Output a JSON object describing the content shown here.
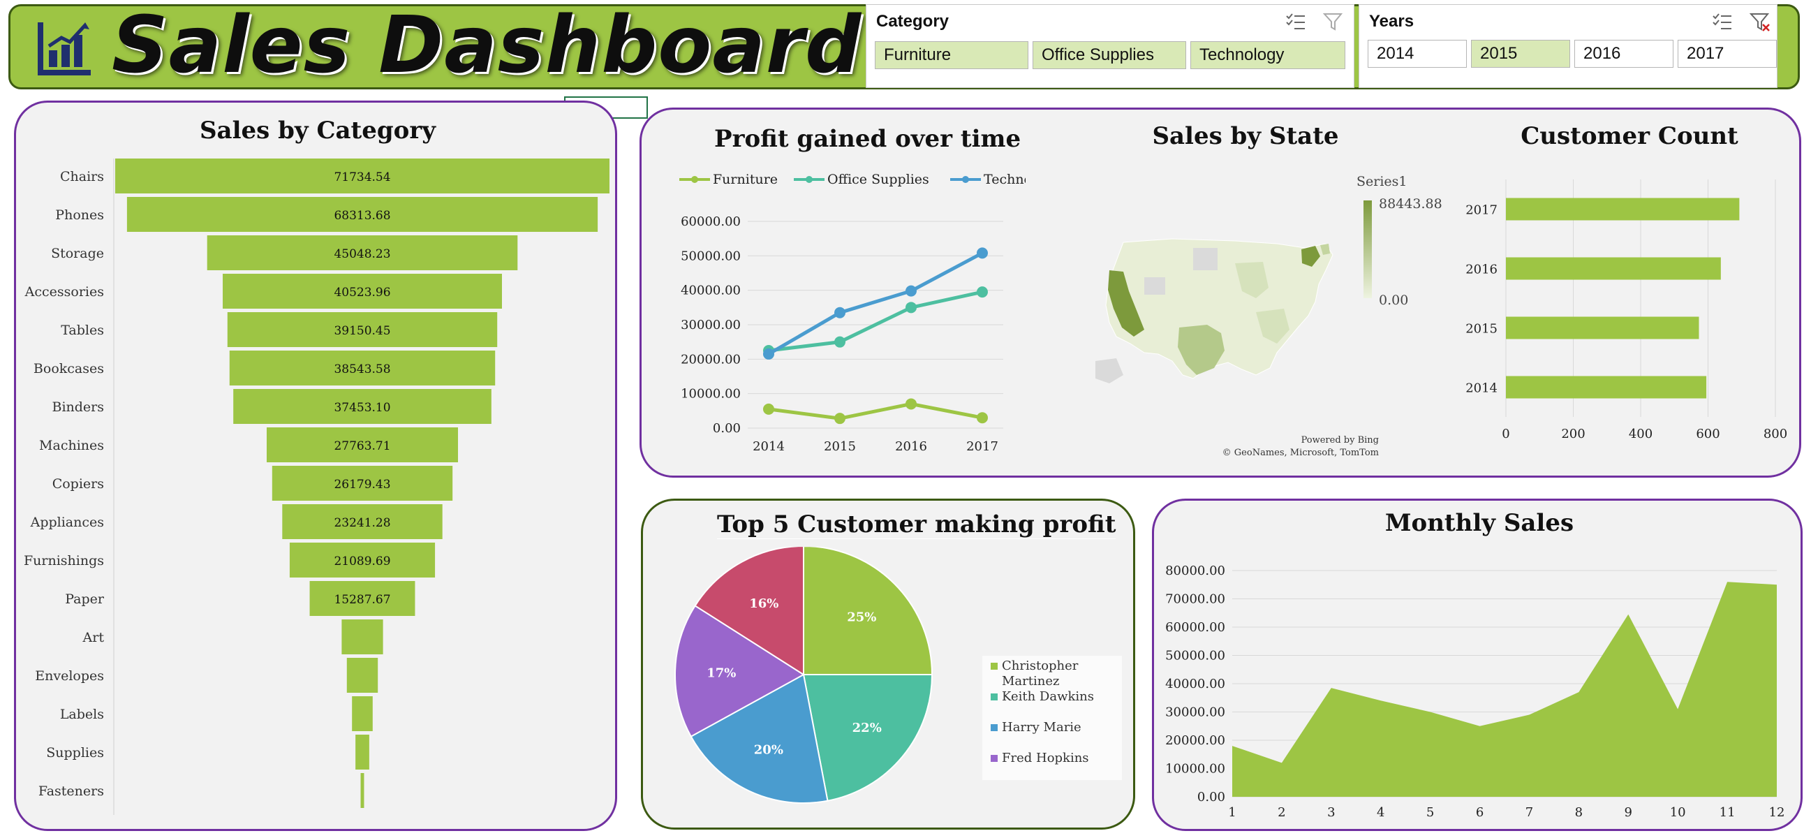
{
  "header": {
    "title": "Sales Dashboard",
    "logo_icon": "bar-chart-icon"
  },
  "slicers": {
    "category": {
      "title": "Category",
      "items": [
        {
          "label": "Furniture",
          "selected": true
        },
        {
          "label": "Office Supplies",
          "selected": true
        },
        {
          "label": "Technology",
          "selected": true
        }
      ],
      "icons": [
        "multi-select-icon",
        "clear-filter-icon"
      ]
    },
    "years": {
      "title": "Years",
      "items": [
        {
          "label": "2014",
          "selected": false
        },
        {
          "label": "2015",
          "selected": true
        },
        {
          "label": "2016",
          "selected": false
        },
        {
          "label": "2017",
          "selected": false
        }
      ],
      "icons": [
        "multi-select-icon",
        "clear-filter-icon"
      ]
    }
  },
  "colors": {
    "accent_green": "#9dc544",
    "panel_border_purple": "#7030a0",
    "panel_border_green": "#3c5a12",
    "panel_bg": "#f2f2f2",
    "teal": "#4dbfa0",
    "blue": "#4a9ccf",
    "pink": "#c74b6c",
    "purple": "#9966cc"
  },
  "chart_data": [
    {
      "id": "sales_by_category",
      "type": "bar",
      "title": "Sales by Category",
      "orientation": "horizontal-funnel",
      "categories": [
        "Chairs",
        "Phones",
        "Storage",
        "Accessories",
        "Tables",
        "Bookcases",
        "Binders",
        "Machines",
        "Copiers",
        "Appliances",
        "Furnishings",
        "Paper",
        "Art",
        "Envelopes",
        "Labels",
        "Supplies",
        "Fasteners"
      ],
      "values": [
        71734.54,
        68313.68,
        45048.23,
        40523.96,
        39150.45,
        38543.58,
        37453.1,
        27763.71,
        26179.43,
        23241.28,
        21089.69,
        15287.67,
        6000,
        4500,
        3000,
        2000,
        500
      ],
      "value_labels": [
        "71734.54",
        "68313.68",
        "45048.23",
        "40523.96",
        "39150.45",
        "38543.58",
        "37453.10",
        "27763.71",
        "26179.43",
        "23241.28",
        "21089.69",
        "15287.67",
        "",
        "",
        "",
        "",
        ""
      ]
    },
    {
      "id": "profit_over_time",
      "type": "line",
      "title": "Profit gained over time",
      "x": [
        "2014",
        "2015",
        "2016",
        "2017"
      ],
      "series": [
        {
          "name": "Furniture",
          "values": [
            5500,
            2800,
            7000,
            3000
          ],
          "color": "#9dc544"
        },
        {
          "name": "Office Supplies",
          "values": [
            22500,
            25000,
            35000,
            39500
          ],
          "color": "#4dbfa0"
        },
        {
          "name": "Technology",
          "values": [
            21500,
            33500,
            39800,
            50800
          ],
          "color": "#4a9ccf"
        }
      ],
      "yticks": [
        "0.00",
        "10000.00",
        "20000.00",
        "30000.00",
        "40000.00",
        "50000.00",
        "60000.00"
      ],
      "ylim": [
        0,
        60000
      ],
      "legend": "top"
    },
    {
      "id": "sales_by_state",
      "type": "map",
      "title": "Sales by State",
      "series_name": "Series1",
      "scale_max": "88443.88",
      "scale_min": "0.00",
      "attribution_line1": "Powered by Bing",
      "attribution_line2": "© GeoNames, Microsoft, TomTom"
    },
    {
      "id": "customer_count",
      "type": "bar",
      "title": "Customer Count",
      "orientation": "horizontal",
      "categories": [
        "2017",
        "2016",
        "2015",
        "2014"
      ],
      "values": [
        693,
        638,
        573,
        595
      ],
      "xticks": [
        "0",
        "200",
        "400",
        "600",
        "800"
      ],
      "xlim": [
        0,
        800
      ]
    },
    {
      "id": "top5_customers",
      "type": "pie",
      "title": "Top 5 Customer making profit",
      "slices": [
        {
          "name": "Christopher Martinez",
          "value": 25,
          "label": "25%",
          "color": "#9dc544"
        },
        {
          "name": "Keith Dawkins",
          "value": 22,
          "label": "22%",
          "color": "#4dbfa0"
        },
        {
          "name": "Harry Marie",
          "value": 20,
          "label": "20%",
          "color": "#4a9ccf"
        },
        {
          "name": "Fred Hopkins",
          "value": 17,
          "label": "17%",
          "color": "#9966cc"
        },
        {
          "name": "",
          "value": 16,
          "label": "16%",
          "color": "#c74b6c"
        }
      ]
    },
    {
      "id": "monthly_sales",
      "type": "area",
      "title": "Monthly Sales",
      "x": [
        "1",
        "2",
        "3",
        "4",
        "5",
        "6",
        "7",
        "8",
        "9",
        "10",
        "11",
        "12"
      ],
      "values": [
        18000,
        12000,
        38500,
        34000,
        30000,
        25000,
        29000,
        37000,
        64500,
        31000,
        76000,
        75000
      ],
      "yticks": [
        "0.00",
        "10000.00",
        "20000.00",
        "30000.00",
        "40000.00",
        "50000.00",
        "60000.00",
        "70000.00",
        "80000.00"
      ],
      "ylim": [
        0,
        80000
      ],
      "color": "#9dc544"
    }
  ]
}
